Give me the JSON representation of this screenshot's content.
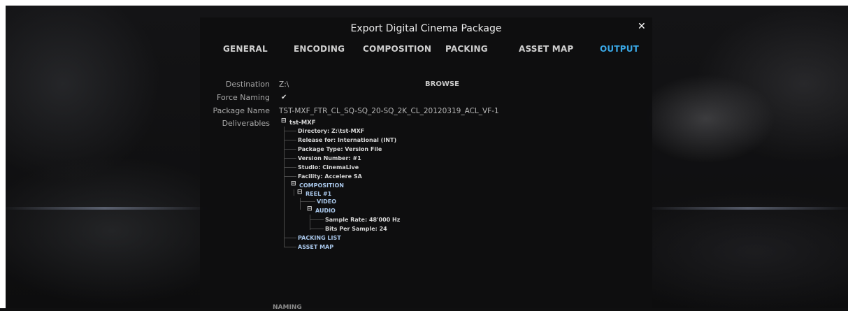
{
  "dialog": {
    "title": "Export Digital Cinema Package",
    "close_icon": "close-icon"
  },
  "tabs": [
    {
      "label": "GENERAL",
      "active": false
    },
    {
      "label": "ENCODING",
      "active": false
    },
    {
      "label": "COMPOSITION",
      "active": false
    },
    {
      "label": "PACKING",
      "active": false
    },
    {
      "label": "ASSET MAP",
      "active": false
    },
    {
      "label": "OUTPUT",
      "active": true
    }
  ],
  "output": {
    "destination_label": "Destination",
    "destination_value": "Z:\\",
    "browse_label": "BROWSE",
    "force_naming_label": "Force Naming",
    "force_naming_checked": true,
    "force_naming_icon": "checkmark-icon",
    "package_name_label": "Package Name",
    "package_name_value": "TST-MXF_FTR_CL_SQ-SQ_20-SQ_2K_CL_20120319_ACL_VF-1",
    "deliverables_label": "Deliverables"
  },
  "deliverables_tree": {
    "root": "tst-MXF",
    "details": [
      "Directory: Z:\\tst-MXF",
      "Release for: International (INT)",
      "Package Type: Version File",
      "Version Number: #1",
      "Studio: CinemaLive",
      "Facility: Accelere SA"
    ],
    "composition": "COMPOSITION",
    "reel": "REEL #1",
    "video": "VIDEO",
    "audio": "AUDIO",
    "audio_details": [
      "Sample Rate: 48'000 Hz",
      "Bits Per Sample: 24"
    ],
    "packing_list": "PACKING LIST",
    "asset_map": "ASSET MAP",
    "collapse_icon": "minus-icon"
  },
  "partial_bottom_text": "NAMING",
  "colors": {
    "active_tab": "#3aa8e6",
    "dialog_bg": "#0e0e0f",
    "tree_blue": "#a9c7ea"
  }
}
